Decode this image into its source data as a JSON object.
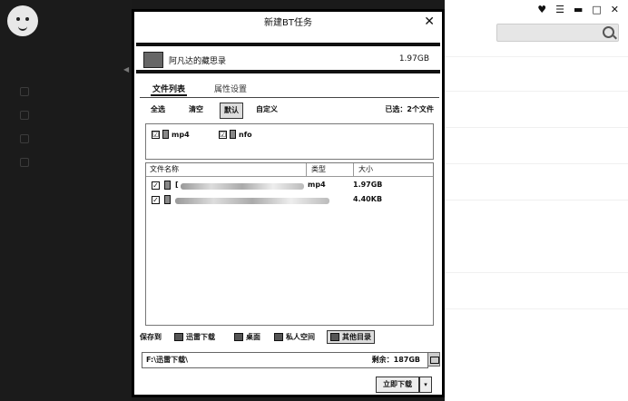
{
  "window_controls": {
    "skin": "♥",
    "menu": "☰",
    "minimize": "▬",
    "maximize": "□",
    "close": "✕"
  },
  "dialog": {
    "title": "新建BT任务",
    "close_label": "✕",
    "task": {
      "name": "阿凡达的藏思录",
      "size": "1.97GB"
    },
    "tabs": [
      {
        "label": "文件列表"
      },
      {
        "label": "属性设置"
      }
    ],
    "buttons": {
      "select_all": "全选",
      "clear": "清空",
      "default": "默认",
      "custom": "自定义"
    },
    "selected_info": "已选：2个文件",
    "types": [
      {
        "label": "mp4",
        "checked": "☑"
      },
      {
        "label": "nfo",
        "checked": "☑"
      }
    ],
    "file_table": {
      "headers": {
        "name": "文件名称",
        "type": "类型",
        "size": "大小"
      },
      "rows": [
        {
          "name_prefix": "[",
          "type": "mp4",
          "size": "1.97GB"
        },
        {
          "name_prefix": "",
          "type": "",
          "size": "4.40KB"
        }
      ]
    },
    "save_to": {
      "label": "保存到",
      "options": [
        {
          "label": "迅雷下载"
        },
        {
          "label": "桌面"
        },
        {
          "label": "私人空间"
        },
        {
          "label": "其他目录"
        }
      ]
    },
    "path": "F:\\迅雷下载\\",
    "free_space": "剩余：187GB",
    "download_button": "立即下载",
    "download_arrow": "▾"
  }
}
